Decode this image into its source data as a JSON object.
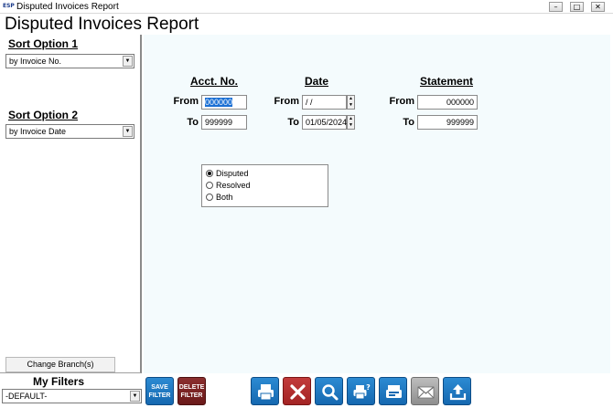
{
  "window": {
    "title": "Disputed Invoices Report",
    "app_icon_text": "ESP",
    "controls": {
      "minimize": "–",
      "maximize": "□",
      "close": "✕"
    }
  },
  "report_title": "Disputed Invoices Report",
  "sort": {
    "option1_label": "Sort Option 1",
    "option1_value": "by Invoice No.",
    "option2_label": "Sort Option 2",
    "option2_value": "by Invoice Date"
  },
  "change_branch_label": "Change Branch(s)",
  "filters": {
    "acct": {
      "header": "Acct. No.",
      "from_label": "From",
      "to_label": "To",
      "from_value": "000000",
      "to_value": "999999"
    },
    "date": {
      "header": "Date",
      "from_label": "From",
      "to_label": "To",
      "from_value": " / /",
      "to_value": "01/05/2024"
    },
    "statement": {
      "header": "Statement",
      "from_label": "From",
      "to_label": "To",
      "from_value": "000000",
      "to_value": "999999"
    }
  },
  "status_options": [
    {
      "label": "Disputed",
      "selected": true
    },
    {
      "label": "Resolved",
      "selected": false
    },
    {
      "label": "Both",
      "selected": false
    }
  ],
  "my_filters": {
    "label": "My Filters",
    "selected": "-DEFAULT-"
  },
  "toolbar": {
    "save_filter_label": "SAVE FILTER",
    "delete_filter_label": "DELETE FILTER",
    "icons": [
      "print-icon",
      "cancel-icon",
      "preview-icon",
      "print-setup-icon",
      "fax-icon",
      "email-icon",
      "export-icon"
    ]
  },
  "colors": {
    "accent_blue": "#1a6fd4",
    "toolbar_blue": "#1f7bc4",
    "cancel_red": "#b02e2e",
    "delete_maroon": "#7a2222",
    "panel_bg": "#f4fbfd"
  }
}
